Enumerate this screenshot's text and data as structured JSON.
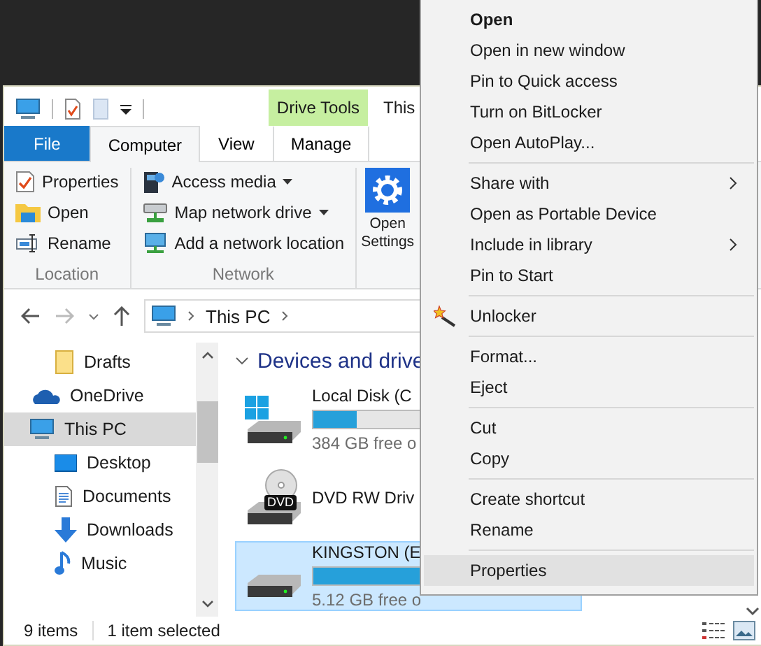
{
  "window": {
    "title": "This",
    "contextual_header": "Drive Tools"
  },
  "ribbon": {
    "tabs": [
      {
        "label": "File",
        "kind": "file",
        "selected": false
      },
      {
        "label": "Computer",
        "kind": "tab",
        "selected": true
      },
      {
        "label": "View",
        "kind": "tab",
        "selected": false
      },
      {
        "label": "Manage",
        "kind": "contextual",
        "selected": false
      }
    ],
    "groups": [
      {
        "label": "Location",
        "items": [
          {
            "label": "Properties",
            "dropdown": false
          },
          {
            "label": "Open",
            "dropdown": false
          },
          {
            "label": "Rename",
            "dropdown": false
          }
        ]
      },
      {
        "label": "Network",
        "items": [
          {
            "label": "Access media",
            "dropdown": true
          },
          {
            "label": "Map network drive",
            "dropdown": true
          },
          {
            "label": "Add a network location",
            "dropdown": false
          }
        ]
      }
    ],
    "big_button": [
      "Open",
      "Settings"
    ]
  },
  "address_bar": {
    "path": "This PC"
  },
  "nav_pane": [
    {
      "children": [
        {
          "label": "Drafts",
          "selected": false
        }
      ]
    },
    {
      "label": "OneDrive",
      "selected": false
    },
    {
      "label": "This PC",
      "selected": true,
      "children": [
        {
          "label": "Desktop",
          "selected": false
        },
        {
          "label": "Documents",
          "selected": false
        },
        {
          "label": "Downloads",
          "selected": false
        },
        {
          "label": "Music",
          "selected": false
        }
      ]
    }
  ],
  "content": {
    "heading": "Devices and drive",
    "drives": [
      {
        "kind": "disk",
        "name": "Local Disk (C",
        "level": 0.17,
        "free": "384 GB free o",
        "selected": false
      },
      {
        "kind": "dvd",
        "name": "DVD RW Driv",
        "badge": "DVD",
        "selected": false
      },
      {
        "kind": "usb",
        "name": "KINGSTON (E",
        "level": 0.63,
        "free": "5.12 GB free o",
        "selected": true
      }
    ]
  },
  "status_bar": {
    "count": "9 items",
    "selection": "1 item selected"
  },
  "context_menu": [
    {
      "kind": "item",
      "label": "Open",
      "default": true,
      "submenu": false,
      "selected": false
    },
    {
      "kind": "item",
      "label": "Open in new window",
      "default": false,
      "submenu": false,
      "selected": false
    },
    {
      "kind": "item",
      "label": "Pin to Quick access",
      "default": false,
      "submenu": false,
      "selected": false
    },
    {
      "kind": "item",
      "label": "Turn on BitLocker",
      "default": false,
      "submenu": false,
      "selected": false
    },
    {
      "kind": "item",
      "label": "Open AutoPlay...",
      "default": false,
      "submenu": false,
      "selected": false
    },
    {
      "kind": "separator"
    },
    {
      "kind": "item",
      "label": "Share with",
      "default": false,
      "submenu": true,
      "selected": false
    },
    {
      "kind": "item",
      "label": "Open as Portable Device",
      "default": false,
      "submenu": false,
      "selected": false
    },
    {
      "kind": "item",
      "label": "Include in library",
      "default": false,
      "submenu": true,
      "selected": false
    },
    {
      "kind": "item",
      "label": "Pin to Start",
      "default": false,
      "submenu": false,
      "selected": false
    },
    {
      "kind": "separator"
    },
    {
      "kind": "wand",
      "label": "Unlocker",
      "default": false,
      "submenu": false,
      "selected": false
    },
    {
      "kind": "separator"
    },
    {
      "kind": "item",
      "label": "Format...",
      "default": false,
      "submenu": false,
      "selected": false
    },
    {
      "kind": "item",
      "label": "Eject",
      "default": false,
      "submenu": false,
      "selected": false
    },
    {
      "kind": "separator"
    },
    {
      "kind": "item",
      "label": "Cut",
      "default": false,
      "submenu": false,
      "selected": false
    },
    {
      "kind": "item",
      "label": "Copy",
      "default": false,
      "submenu": false,
      "selected": false
    },
    {
      "kind": "separator"
    },
    {
      "kind": "item",
      "label": "Create shortcut",
      "default": false,
      "submenu": false,
      "selected": false
    },
    {
      "kind": "item",
      "label": "Rename",
      "default": false,
      "submenu": false,
      "selected": false
    },
    {
      "kind": "separator"
    },
    {
      "kind": "item",
      "label": "Properties",
      "default": false,
      "submenu": false,
      "selected": true
    }
  ]
}
